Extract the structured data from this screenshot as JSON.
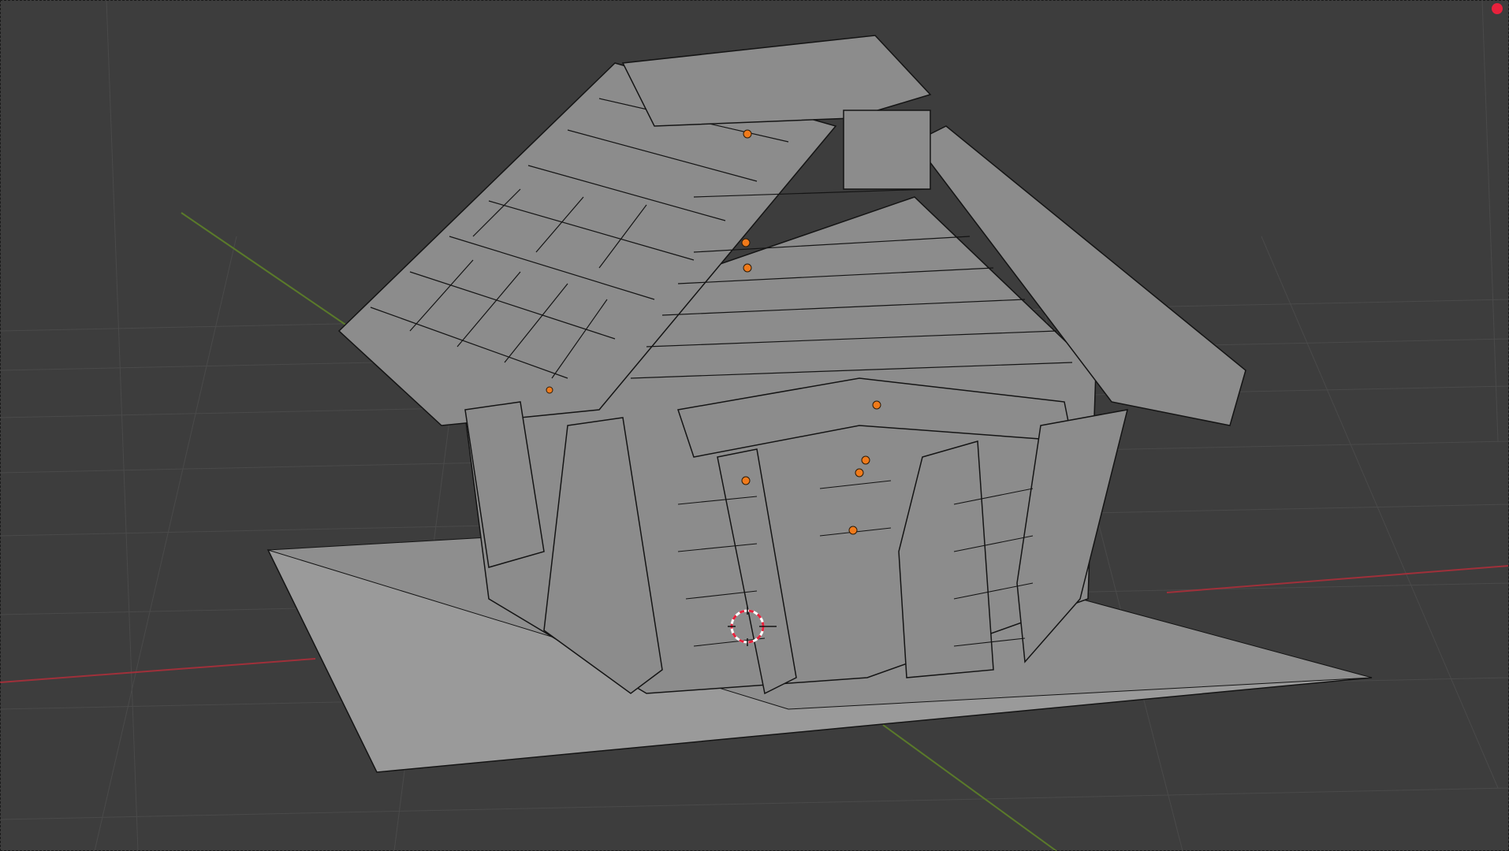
{
  "viewport": {
    "background_color": "#3d3d3d",
    "grid_color": "#4a4a4a",
    "x_axis_color": "#a0303a",
    "y_axis_color": "#5a7a2a",
    "mesh_fill": "#8c8c8c",
    "mesh_wire": "#141414",
    "object_origin_color": "#f07a1a",
    "cursor_color": "#e8213c",
    "object": "house-mesh",
    "object_origin_count": 9
  },
  "recording_indicator": {
    "color": "#e8213c"
  }
}
